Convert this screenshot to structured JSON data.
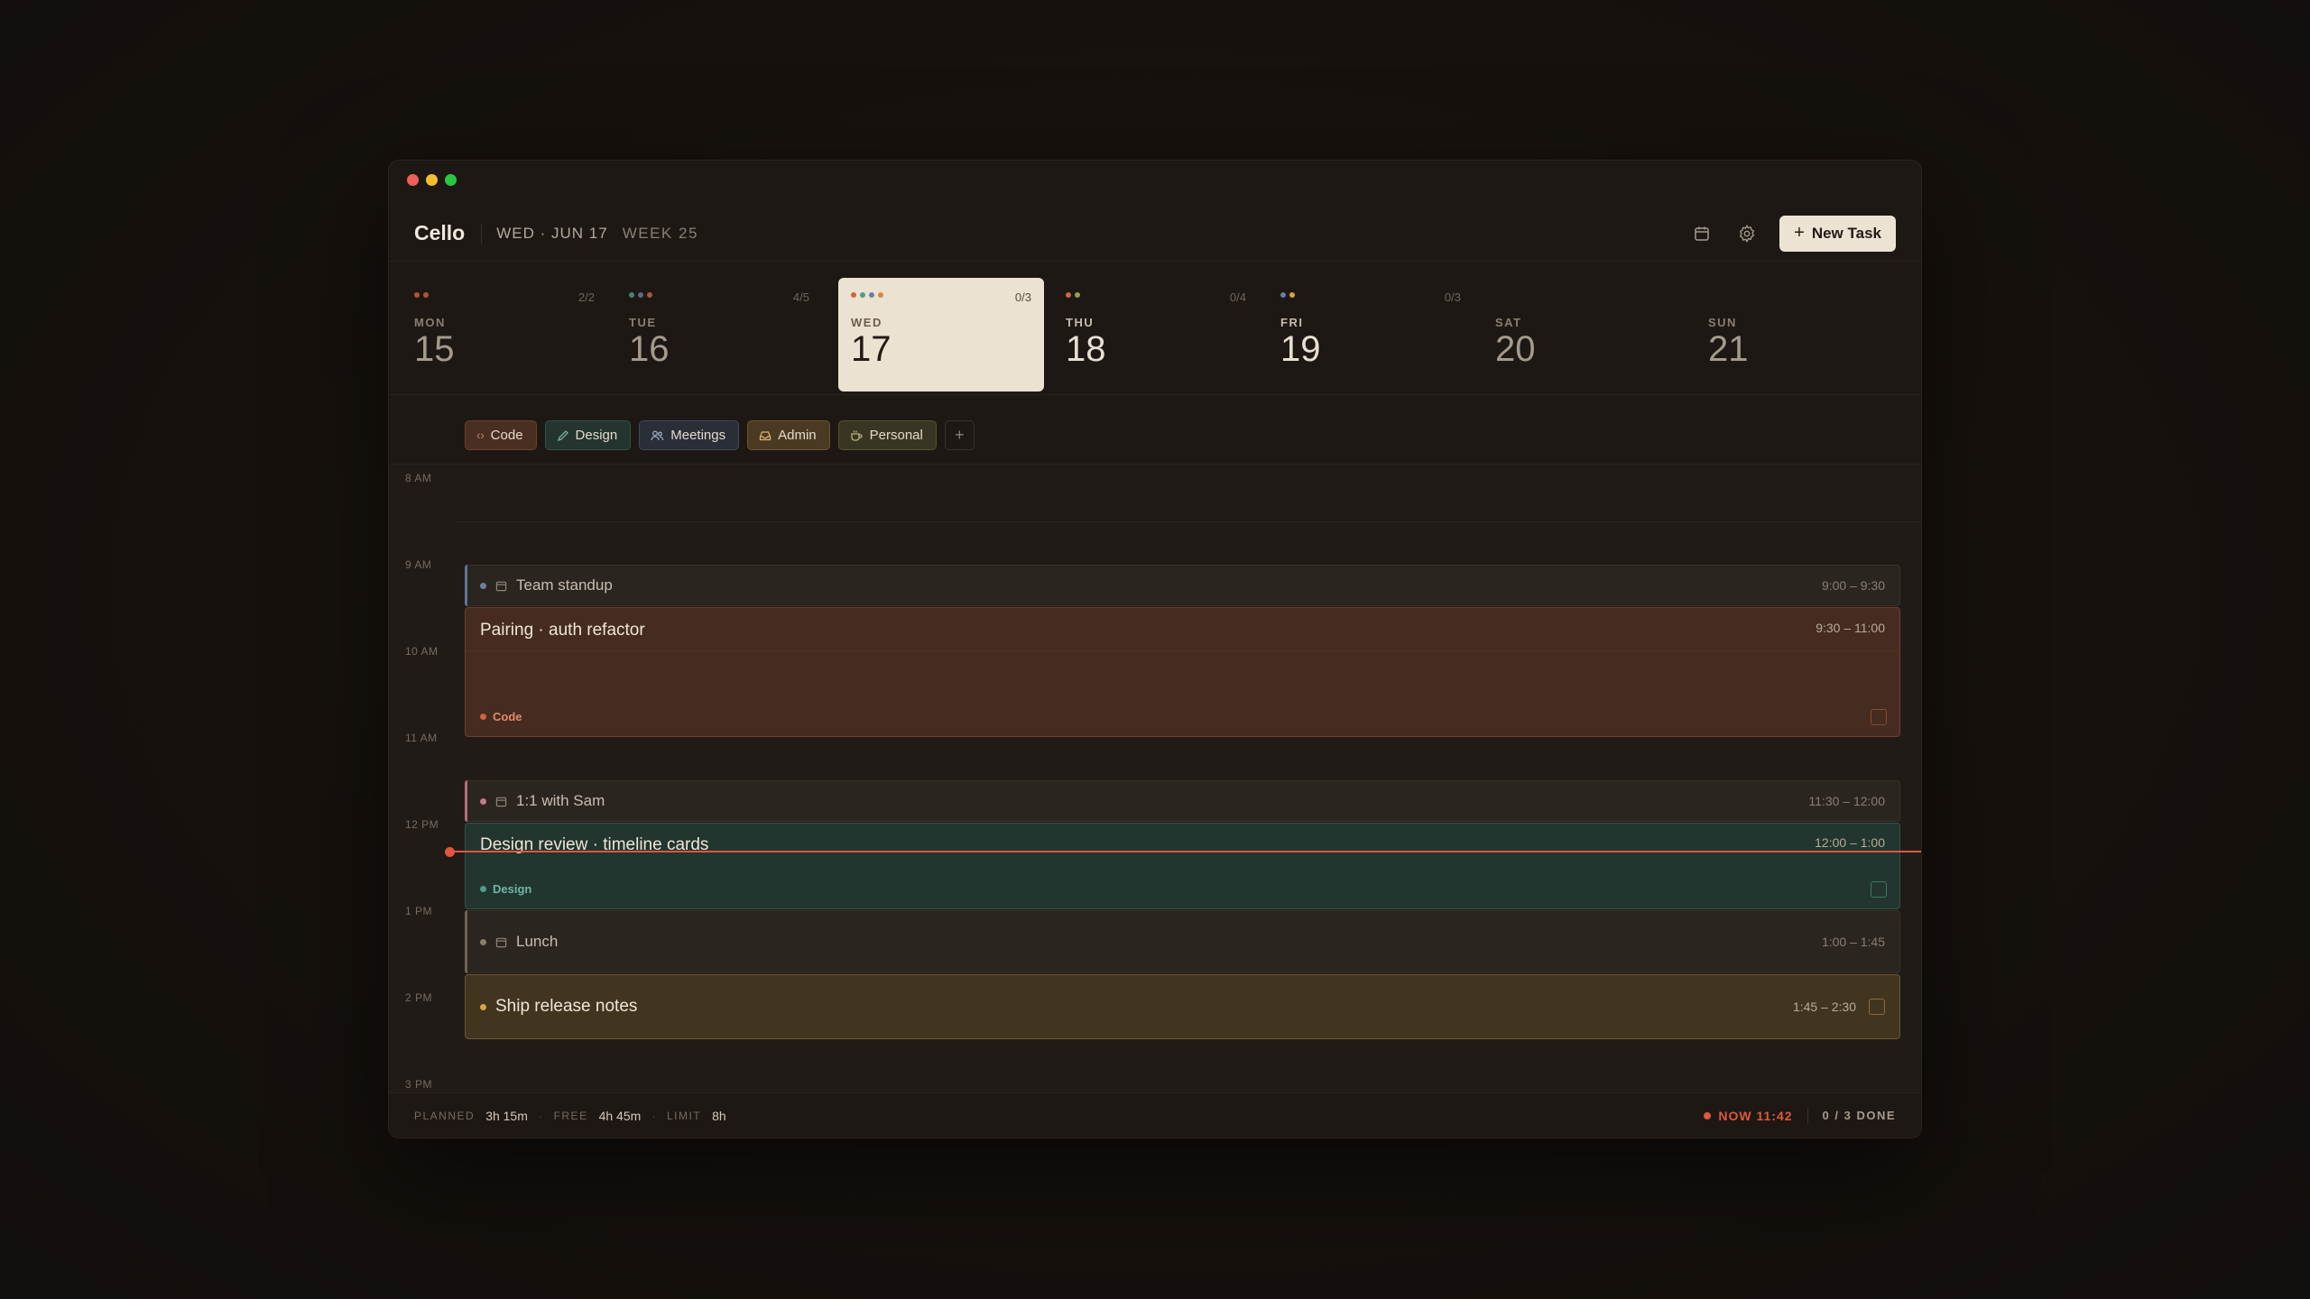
{
  "app": {
    "title": "Cello",
    "date": "WED · JUN 17",
    "week": "WEEK 25",
    "new_task_label": "New Task",
    "new_task_icon": "plus-icon"
  },
  "days": [
    {
      "name": "MON",
      "num": "15",
      "count": "2/2",
      "dots": [
        "#c0613f",
        "#c0613f"
      ]
    },
    {
      "name": "TUE",
      "num": "16",
      "count": "4/5",
      "dots": [
        "#4f7f74",
        "#5a6a86",
        "#c0613f"
      ]
    },
    {
      "name": "WED",
      "num": "17",
      "count": "0/3",
      "dots": [
        "#d0643f",
        "#4f9d8a",
        "#6a7fa6",
        "#d38a3a"
      ]
    },
    {
      "name": "THU",
      "num": "18",
      "count": "0/4",
      "dots": [
        "#d0643f",
        "#4f9d8a"
      ]
    },
    {
      "name": "FRI",
      "num": "19",
      "count": "0/3",
      "dots": [
        "#6a7fa6",
        "#d9a43f"
      ]
    },
    {
      "name": "SAT",
      "num": "20",
      "count": "",
      "dots": []
    },
    {
      "name": "SUN",
      "num": "21",
      "count": "",
      "dots": []
    }
  ],
  "tags": [
    {
      "label": "Code",
      "icon": "code-icon"
    },
    {
      "label": "Design",
      "icon": "brush-icon"
    },
    {
      "label": "Meetings",
      "icon": "users-icon"
    },
    {
      "label": "Admin",
      "icon": "inbox-icon"
    },
    {
      "label": "Personal",
      "icon": "coffee-icon"
    }
  ],
  "hours": [
    "8 AM",
    "9 AM",
    "10 AM",
    "11 AM",
    "12 PM",
    "1 PM",
    "2 PM",
    "3 PM"
  ],
  "events": {
    "standup": {
      "title": "Team standup",
      "time": "9:00 – 9:30"
    },
    "pairing": {
      "title": "Pairing · auth refactor",
      "time": "9:30 – 11:00",
      "tag": "Code"
    },
    "oneonone": {
      "title": "1:1 with Sam",
      "time": "11:30 – 12:00"
    },
    "review": {
      "title": "Design review · timeline cards",
      "time": "12:00 – 1:00",
      "tag": "Design"
    },
    "lunch": {
      "title": "Lunch",
      "time": "1:00 – 1:45"
    },
    "ship": {
      "title": "Ship release notes",
      "time": "1:45 – 2:30"
    }
  },
  "footer": {
    "planned_label": "PLANNED",
    "planned": "3h 15m",
    "free_label": "FREE",
    "free": "4h 45m",
    "limit_label": "LIMIT",
    "limit": "8h",
    "now": "NOW 11:42",
    "done": "0 / 3 DONE"
  },
  "colors": {
    "accent": "#e0573d",
    "code": "#d0643f",
    "design": "#4f9d8a",
    "meetings": "#6a7fa6",
    "admin": "#d9a43f"
  }
}
